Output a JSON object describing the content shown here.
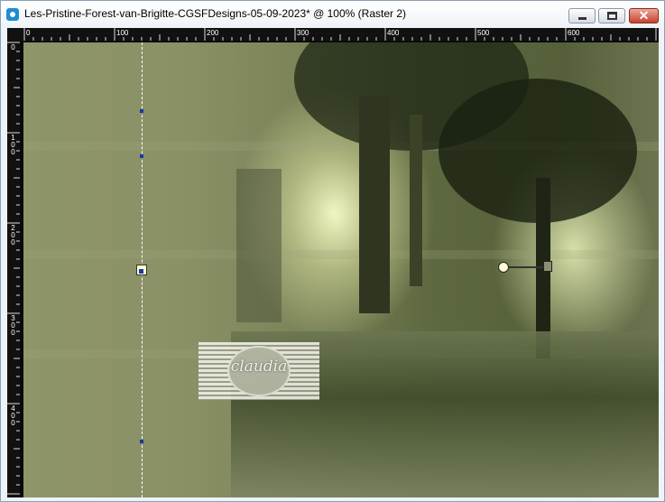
{
  "window": {
    "title": "Les-Pristine-Forest-van-Brigitte-CGSFDesigns-05-09-2023* @ 100% (Raster 2)",
    "icon": "paintshop-pro-app-icon",
    "controls": {
      "minimize": "minimize-icon",
      "maximize": "maximize-icon",
      "close": "close-icon",
      "close_glyph": "✕"
    }
  },
  "ruler": {
    "top_labels": [
      "0",
      "100",
      "200",
      "300",
      "400",
      "500",
      "600"
    ],
    "left_labels": [
      {
        "chars": [
          "0"
        ]
      },
      {
        "chars": [
          "1",
          "0",
          "0"
        ]
      },
      {
        "chars": [
          "2",
          "0",
          "0"
        ]
      },
      {
        "chars": [
          "3",
          "0",
          "0"
        ]
      },
      {
        "chars": [
          "4",
          "0",
          "0"
        ]
      }
    ]
  },
  "canvas": {
    "layer": "Raster 2",
    "watermark": {
      "text": "claudia",
      "icon": "claudia-watermark-logo"
    },
    "colors": {
      "close_red": "#c7412c",
      "ruler_bg": "#111111",
      "guide": "#ffffff",
      "marker_blue": "#1a3aa0"
    }
  }
}
